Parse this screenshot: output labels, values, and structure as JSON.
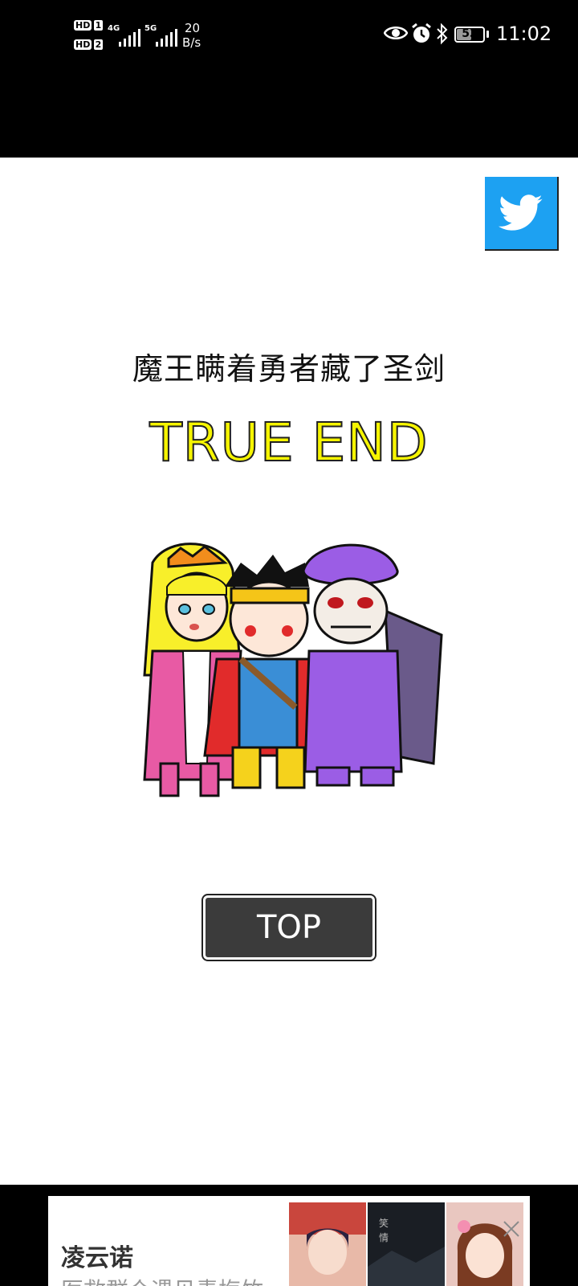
{
  "status_bar": {
    "sim1_badge": "HD",
    "sim1_num": "1",
    "sim2_badge": "HD",
    "sim2_num": "2",
    "network_1": "4G",
    "network_2": "5G",
    "speed_value": "20",
    "speed_unit": "B/s",
    "battery": "53",
    "time": "11:02"
  },
  "page": {
    "subtitle": "魔王瞒着勇者藏了圣剑",
    "end_title": "TRUE END",
    "top_button_label": "TOP",
    "twitter_color": "#1da1f2",
    "end_title_color": "#f6f500"
  },
  "ad": {
    "title": "凌云诺",
    "description": "医救群众遇见青梅竹"
  },
  "icons": {
    "share": "twitter-bird-icon",
    "close": "close-icon",
    "eye": "eye-icon",
    "alarm": "alarm-icon",
    "bluetooth": "bluetooth-icon"
  }
}
